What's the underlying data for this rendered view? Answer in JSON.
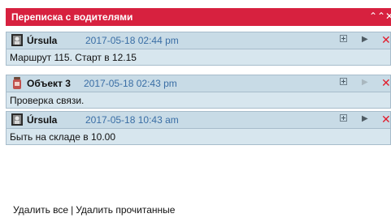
{
  "panel": {
    "title": "Переписка с водителями"
  },
  "messages": [
    {
      "sender": "Úrsula",
      "time": "2017-05-18 02:44 pm",
      "text": "Маршрут 115. Старт в 12.15",
      "icon": "driver-avatar-icon"
    },
    {
      "sender": "Объект 3",
      "time": "2017-05-18 02:43 pm",
      "text": "Проверка связи.",
      "icon": "object-tracker-icon"
    },
    {
      "sender": "Úrsula",
      "time": "2017-05-18 10:43 am",
      "text": "Быть на складе в 10.00",
      "icon": "driver-avatar-icon"
    }
  ],
  "footer": {
    "delete_all": "Удалить все",
    "separator": "|",
    "delete_read": "Удалить прочитанные"
  },
  "colors": {
    "titlebar": "#d7213f",
    "header": "#c8dbe6",
    "body": "#d7e6ee",
    "time": "#3a6ea5",
    "delete": "#e21c2b"
  }
}
